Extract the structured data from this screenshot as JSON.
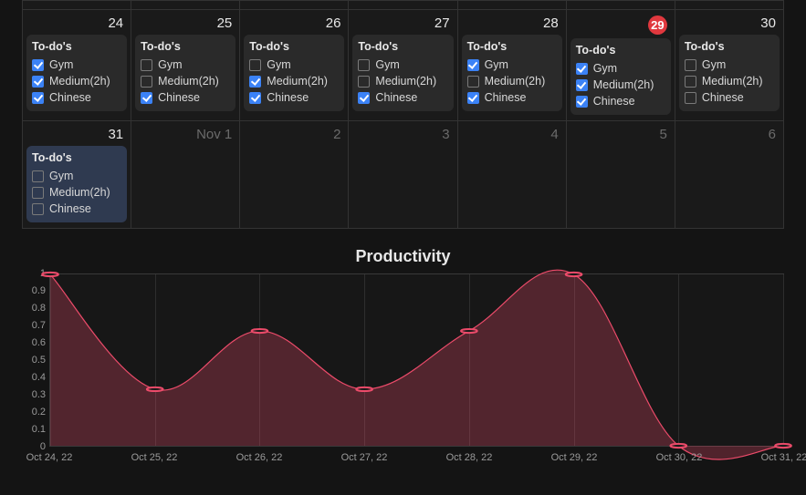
{
  "calendar": {
    "rows": [
      {
        "stub": true,
        "cells": [
          {},
          {},
          {},
          {},
          {},
          {},
          {}
        ]
      },
      {
        "cells": [
          {
            "num": "24",
            "dim": false,
            "today": false,
            "card": {
              "title": "To-do's",
              "hl": false,
              "items": [
                {
                  "label": "Gym",
                  "checked": true
                },
                {
                  "label": "Medium(2h)",
                  "checked": true
                },
                {
                  "label": "Chinese",
                  "checked": true
                }
              ]
            }
          },
          {
            "num": "25",
            "dim": false,
            "today": false,
            "card": {
              "title": "To-do's",
              "hl": false,
              "items": [
                {
                  "label": "Gym",
                  "checked": false
                },
                {
                  "label": "Medium(2h)",
                  "checked": false
                },
                {
                  "label": "Chinese",
                  "checked": true
                }
              ]
            }
          },
          {
            "num": "26",
            "dim": false,
            "today": false,
            "card": {
              "title": "To-do's",
              "hl": false,
              "items": [
                {
                  "label": "Gym",
                  "checked": false
                },
                {
                  "label": "Medium(2h)",
                  "checked": true
                },
                {
                  "label": "Chinese",
                  "checked": true
                }
              ]
            }
          },
          {
            "num": "27",
            "dim": false,
            "today": false,
            "card": {
              "title": "To-do's",
              "hl": false,
              "items": [
                {
                  "label": "Gym",
                  "checked": false
                },
                {
                  "label": "Medium(2h)",
                  "checked": false
                },
                {
                  "label": "Chinese",
                  "checked": true
                }
              ]
            }
          },
          {
            "num": "28",
            "dim": false,
            "today": false,
            "card": {
              "title": "To-do's",
              "hl": false,
              "items": [
                {
                  "label": "Gym",
                  "checked": true
                },
                {
                  "label": "Medium(2h)",
                  "checked": false
                },
                {
                  "label": "Chinese",
                  "checked": true
                }
              ]
            }
          },
          {
            "num": "29",
            "dim": false,
            "today": true,
            "card": {
              "title": "To-do's",
              "hl": false,
              "items": [
                {
                  "label": "Gym",
                  "checked": true
                },
                {
                  "label": "Medium(2h)",
                  "checked": true
                },
                {
                  "label": "Chinese",
                  "checked": true
                }
              ]
            }
          },
          {
            "num": "30",
            "dim": false,
            "today": false,
            "card": {
              "title": "To-do's",
              "hl": false,
              "items": [
                {
                  "label": "Gym",
                  "checked": false
                },
                {
                  "label": "Medium(2h)",
                  "checked": false
                },
                {
                  "label": "Chinese",
                  "checked": false
                }
              ]
            }
          }
        ]
      },
      {
        "cells": [
          {
            "num": "31",
            "dim": false,
            "today": false,
            "card": {
              "title": "To-do's",
              "hl": true,
              "items": [
                {
                  "label": "Gym",
                  "checked": false
                },
                {
                  "label": "Medium(2h)",
                  "checked": false
                },
                {
                  "label": "Chinese",
                  "checked": false
                }
              ]
            }
          },
          {
            "num": "Nov 1",
            "dim": true,
            "today": false
          },
          {
            "num": "2",
            "dim": true,
            "today": false
          },
          {
            "num": "3",
            "dim": true,
            "today": false
          },
          {
            "num": "4",
            "dim": true,
            "today": false
          },
          {
            "num": "5",
            "dim": true,
            "today": false
          },
          {
            "num": "6",
            "dim": true,
            "today": false
          }
        ]
      }
    ]
  },
  "chart_data": {
    "type": "area",
    "title": "Productivity",
    "xlabel": "",
    "ylabel": "",
    "ylim": [
      0,
      1
    ],
    "yticks": [
      0,
      0.1,
      0.2,
      0.3,
      0.4,
      0.5,
      0.6,
      0.7,
      0.8,
      0.9,
      1
    ],
    "categories": [
      "Oct 24, 22",
      "Oct 25, 22",
      "Oct 26, 22",
      "Oct 27, 22",
      "Oct 28, 22",
      "Oct 29, 22",
      "Oct 30, 22",
      "Oct 31, 22"
    ],
    "values": [
      1.0,
      0.33,
      0.67,
      0.33,
      0.67,
      1.0,
      0.0,
      0.0
    ],
    "color": "#ec4b6a"
  }
}
